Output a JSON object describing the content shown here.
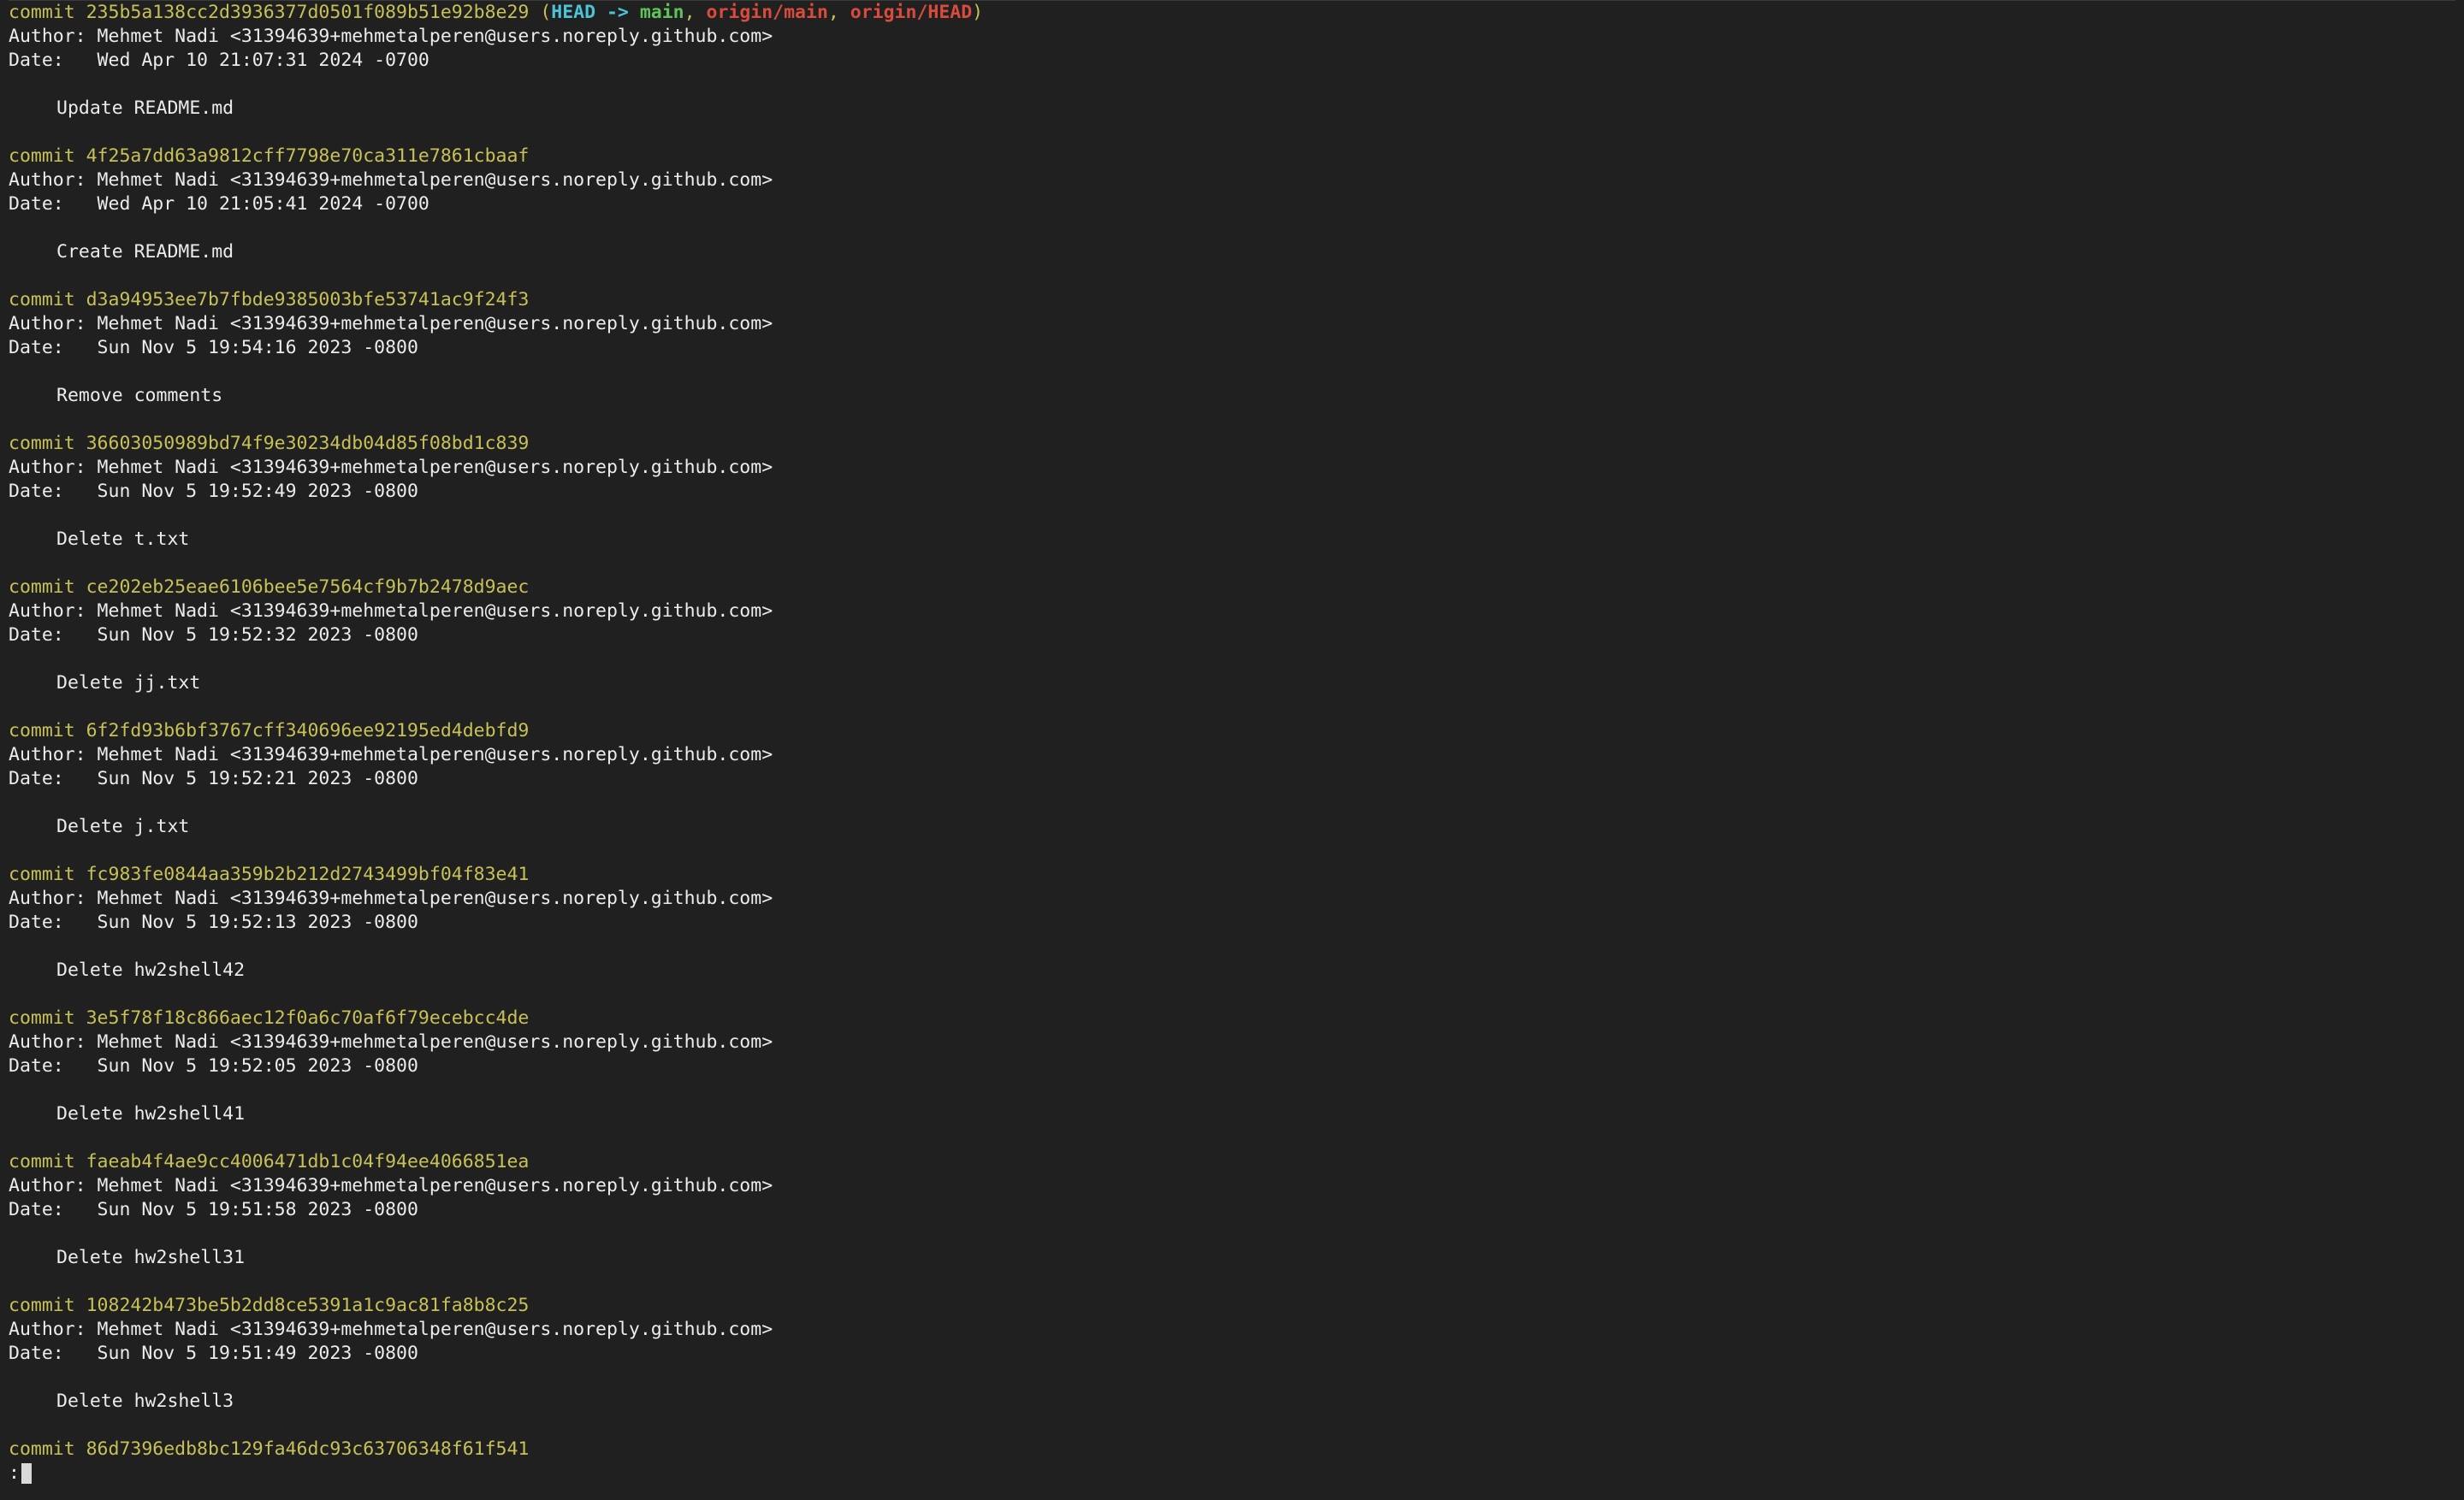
{
  "commits": [
    {
      "commit_prefix": "commit ",
      "hash": "235b5a138cc2d3936377d0501f089b51e92b8e29",
      "author": "Author: Mehmet Nadi <31394639+mehmetalperen@users.noreply.github.com>",
      "date": "Date:   Wed Apr 10 21:07:31 2024 -0700",
      "message": "Update README.md"
    },
    {
      "commit_prefix": "commit ",
      "hash": "4f25a7dd63a9812cff7798e70ca311e7861cbaaf",
      "author": "Author: Mehmet Nadi <31394639+mehmetalperen@users.noreply.github.com>",
      "date": "Date:   Wed Apr 10 21:05:41 2024 -0700",
      "message": "Create README.md"
    },
    {
      "commit_prefix": "commit ",
      "hash": "d3a94953ee7b7fbde9385003bfe53741ac9f24f3",
      "author": "Author: Mehmet Nadi <31394639+mehmetalperen@users.noreply.github.com>",
      "date": "Date:   Sun Nov 5 19:54:16 2023 -0800",
      "message": "Remove comments"
    },
    {
      "commit_prefix": "commit ",
      "hash": "36603050989bd74f9e30234db04d85f08bd1c839",
      "author": "Author: Mehmet Nadi <31394639+mehmetalperen@users.noreply.github.com>",
      "date": "Date:   Sun Nov 5 19:52:49 2023 -0800",
      "message": "Delete t.txt"
    },
    {
      "commit_prefix": "commit ",
      "hash": "ce202eb25eae6106bee5e7564cf9b7b2478d9aec",
      "author": "Author: Mehmet Nadi <31394639+mehmetalperen@users.noreply.github.com>",
      "date": "Date:   Sun Nov 5 19:52:32 2023 -0800",
      "message": "Delete jj.txt"
    },
    {
      "commit_prefix": "commit ",
      "hash": "6f2fd93b6bf3767cff340696ee92195ed4debfd9",
      "author": "Author: Mehmet Nadi <31394639+mehmetalperen@users.noreply.github.com>",
      "date": "Date:   Sun Nov 5 19:52:21 2023 -0800",
      "message": "Delete j.txt"
    },
    {
      "commit_prefix": "commit ",
      "hash": "fc983fe0844aa359b2b212d2743499bf04f83e41",
      "author": "Author: Mehmet Nadi <31394639+mehmetalperen@users.noreply.github.com>",
      "date": "Date:   Sun Nov 5 19:52:13 2023 -0800",
      "message": "Delete hw2shell42"
    },
    {
      "commit_prefix": "commit ",
      "hash": "3e5f78f18c866aec12f0a6c70af6f79ecebcc4de",
      "author": "Author: Mehmet Nadi <31394639+mehmetalperen@users.noreply.github.com>",
      "date": "Date:   Sun Nov 5 19:52:05 2023 -0800",
      "message": "Delete hw2shell41"
    },
    {
      "commit_prefix": "commit ",
      "hash": "faeab4f4ae9cc4006471db1c04f94ee4066851ea",
      "author": "Author: Mehmet Nadi <31394639+mehmetalperen@users.noreply.github.com>",
      "date": "Date:   Sun Nov 5 19:51:58 2023 -0800",
      "message": "Delete hw2shell31"
    },
    {
      "commit_prefix": "commit ",
      "hash": "108242b473be5b2dd8ce5391a1c9ac81fa8b8c25",
      "author": "Author: Mehmet Nadi <31394639+mehmetalperen@users.noreply.github.com>",
      "date": "Date:   Sun Nov 5 19:51:49 2023 -0800",
      "message": "Delete hw2shell3"
    }
  ],
  "last_commit": {
    "commit_prefix": "commit ",
    "hash": "86d7396edb8bc129fa46dc93c63706348f61f541"
  },
  "refs": {
    "open_paren": " (",
    "head": "HEAD",
    "arrow": " -> ",
    "branch": "main",
    "sep1": ", ",
    "remote_main": "origin/main",
    "sep2": ", ",
    "remote_head": "origin/HEAD",
    "close_paren": ")"
  },
  "pager": {
    "prompt": ":"
  },
  "colors": {
    "background": "#202020",
    "commit_hash": "#c8c156",
    "head_ref": "#4bc4d8",
    "local_branch": "#5ec45a",
    "remote_branch": "#d94b3c",
    "text": "#ececec"
  }
}
